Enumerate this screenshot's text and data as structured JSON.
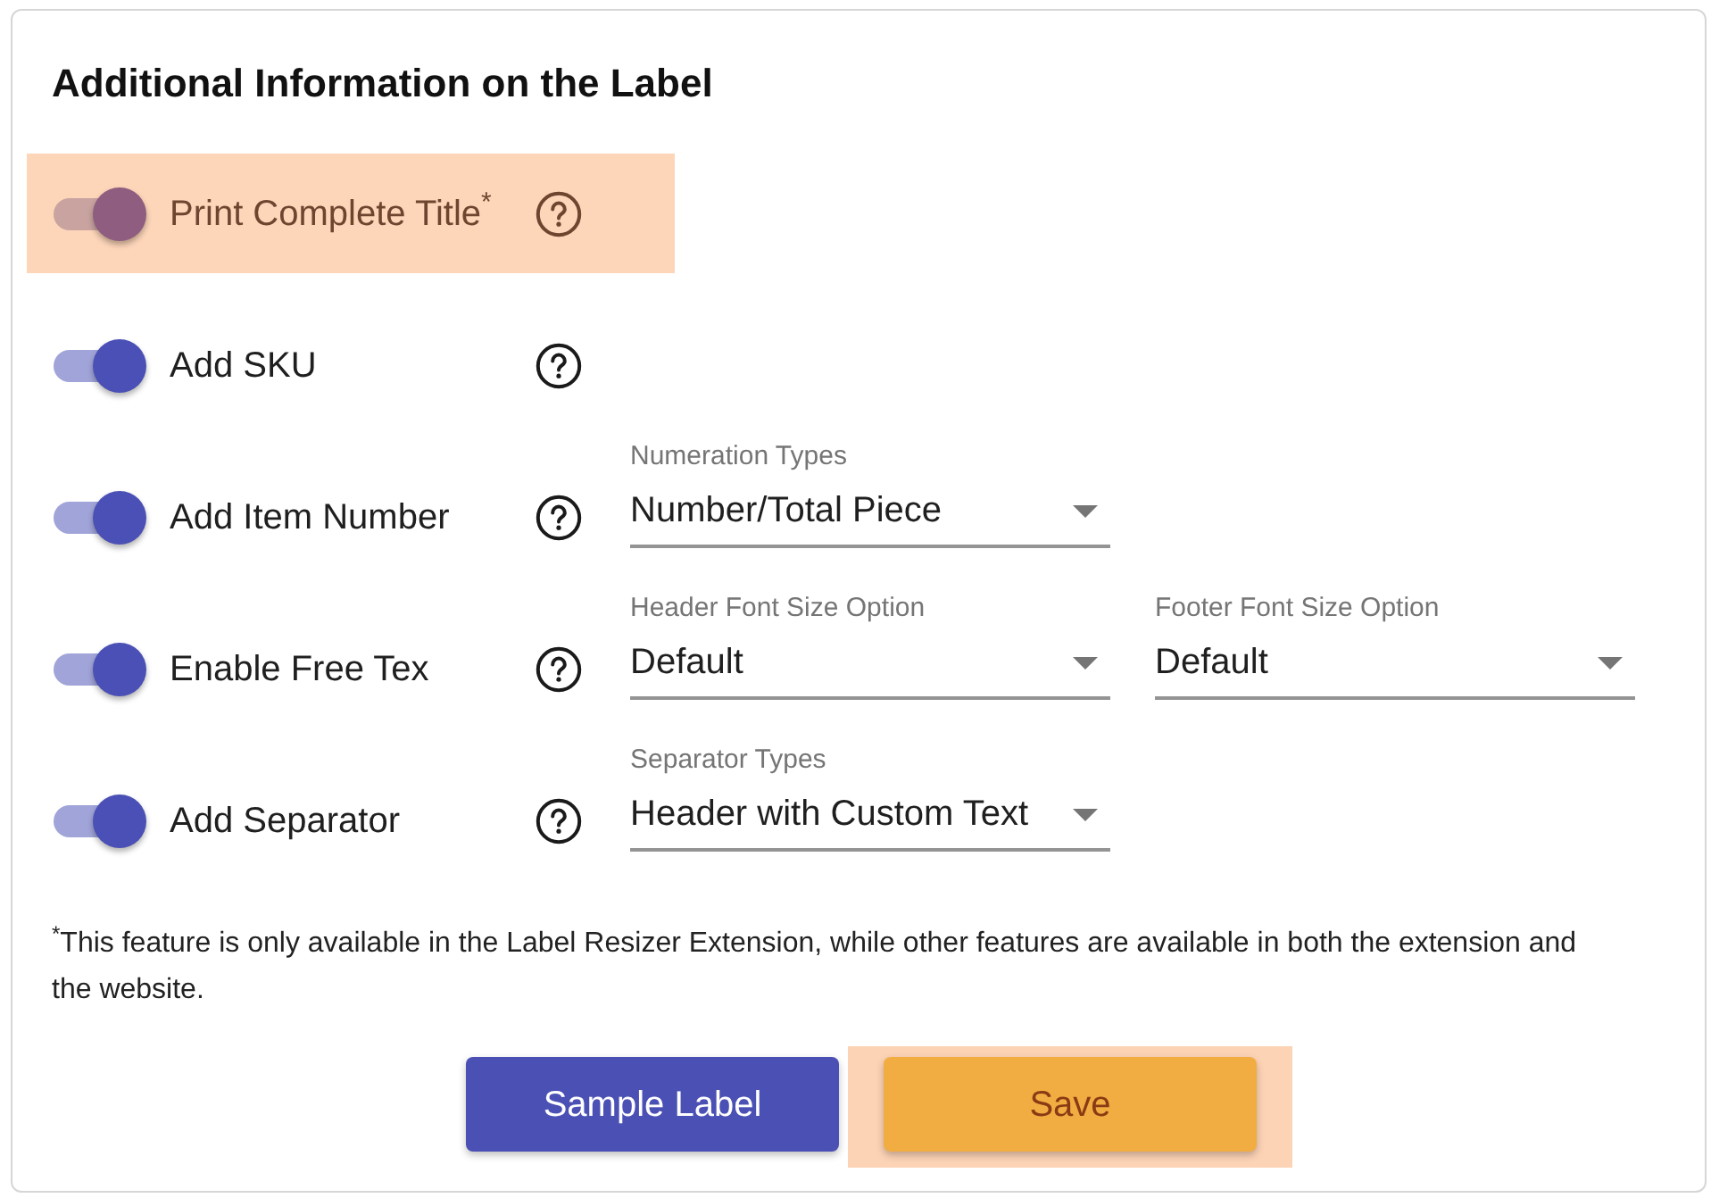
{
  "title": "Additional Information on the Label",
  "options": [
    {
      "label": "Print Complete Title$^{*}$",
      "on": true,
      "highlighted": true
    },
    {
      "label": "Add SKU",
      "on": true,
      "highlighted": false
    },
    {
      "label": "Add Item Number",
      "on": true,
      "highlighted": false,
      "fields": [
        {
          "label": "Numeration Types",
          "value": "Number/Total Piece"
        }
      ]
    },
    {
      "label": "Enable Free Tex",
      "on": true,
      "highlighted": false,
      "fields": [
        {
          "label": "Header Font Size Option",
          "value": "Default"
        },
        {
          "label": "Footer Font Size Option",
          "value": "Default"
        }
      ]
    },
    {
      "label": "Add Separator",
      "on": true,
      "highlighted": false,
      "fields": [
        {
          "label": "Separator Types",
          "value": "Header with Custom Text"
        }
      ]
    }
  ],
  "footnote": "$^{*}$This feature is only available in the Label Resizer Extension, while other features are available in both the extension and the website.",
  "buttons": [
    {
      "label": "Sample Label",
      "kind": "primary",
      "highlighted": false
    },
    {
      "label": "Save",
      "kind": "accent",
      "highlighted": true
    }
  ]
}
